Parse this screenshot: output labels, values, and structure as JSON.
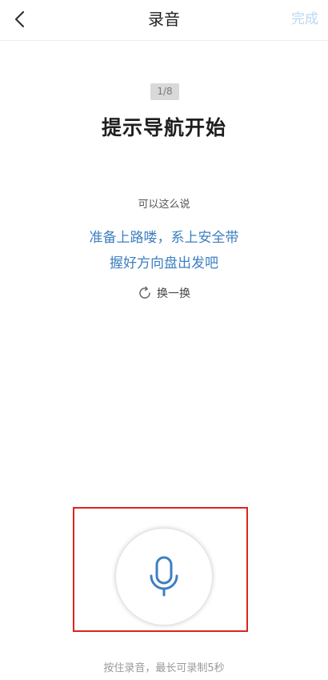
{
  "nav": {
    "title": "录音",
    "done_label": "完成",
    "back_icon": "chevron-left-icon"
  },
  "step": {
    "progress": "1/8",
    "title": "提示导航开始"
  },
  "suggestion": {
    "label": "可以这么说",
    "lines": [
      "准备上路喽，系上安全带",
      "握好方向盘出发吧"
    ],
    "refresh_label": "换一换",
    "refresh_icon": "refresh-icon"
  },
  "record": {
    "mic_icon": "microphone-icon",
    "tip": "按住录音，最长可录制5秒"
  },
  "colors": {
    "accent": "#3d7fc1",
    "done_disabled": "#b9d8f2",
    "highlight": "#d9261c"
  }
}
